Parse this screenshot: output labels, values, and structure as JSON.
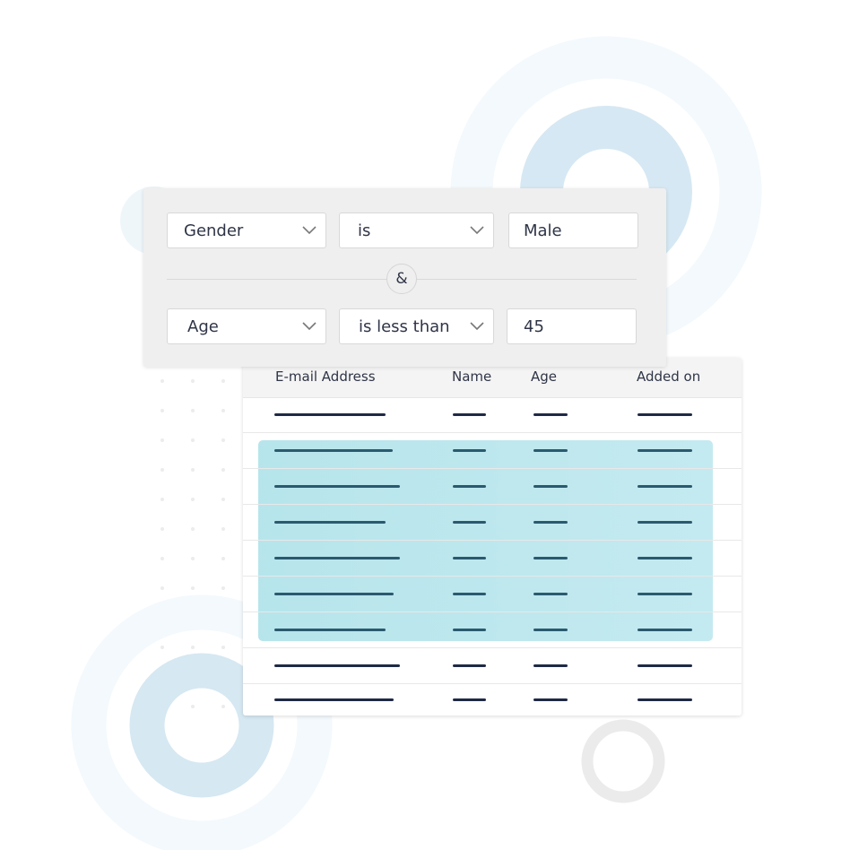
{
  "filter": {
    "rows": [
      {
        "field": "Gender",
        "operator": "is",
        "value": "Male"
      },
      {
        "field": "Age",
        "operator": "is less than",
        "value": "45"
      }
    ],
    "joiner": "&"
  },
  "table": {
    "columns": [
      "E-mail Address",
      "Name",
      "Age",
      "Added on"
    ],
    "row_count": 9,
    "highlighted_rows": [
      1,
      2,
      3,
      4,
      5,
      6
    ]
  },
  "colors": {
    "accent_highlight": "#b9e5ec",
    "text": "#2f3547",
    "placeholder_line": "#1f2a44",
    "ring_blue": "#d4e7f2",
    "ring_light": "#f3f9fc",
    "ring_grey": "#e9e9e9"
  }
}
